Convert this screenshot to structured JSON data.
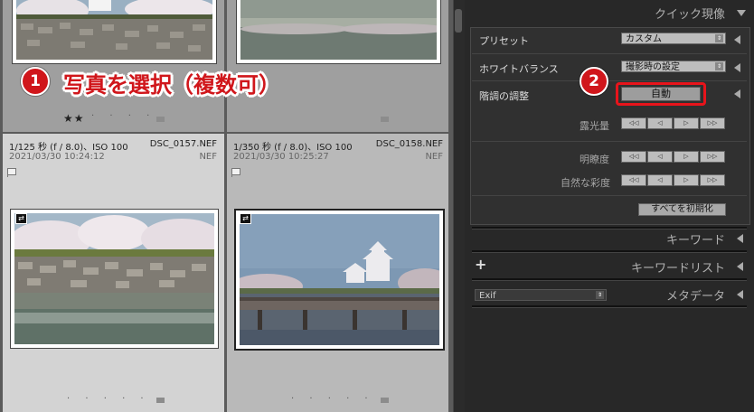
{
  "annotations": {
    "step1": {
      "number": "1",
      "text": "写真を選択（複数可）"
    },
    "step2": {
      "number": "2"
    }
  },
  "grid": {
    "top_row": {
      "rating": "★★",
      "rating_dots": "· · · ·"
    },
    "photos": [
      {
        "exposure": "1/125 秒 (f / 8.0)、ISO 100",
        "filename": "DSC_0157.NEF",
        "datetime": "2021/03/30 10:24:12",
        "filetype": "NEF",
        "sync_badge": "⇄",
        "dots": "· · · · ·"
      },
      {
        "exposure": "1/350 秒 (f / 8.0)、ISO 100",
        "filename": "DSC_0158.NEF",
        "datetime": "2021/03/30 10:25:27",
        "filetype": "NEF",
        "sync_badge": "⇄",
        "dots": "· · · · ·"
      }
    ]
  },
  "quick_develop": {
    "title": "クイック現像",
    "preset": {
      "label": "プリセット",
      "value": "カスタム"
    },
    "white_balance": {
      "label": "ホワイトバランス",
      "value": "撮影時の設定"
    },
    "tone": {
      "label": "階調の調整",
      "auto_button": "自動"
    },
    "exposure": {
      "label": "露光量",
      "buttons": [
        "◁◁",
        "◁",
        "▷",
        "▷▷"
      ]
    },
    "clarity": {
      "label": "明瞭度",
      "buttons": [
        "◁◁",
        "◁",
        "▷",
        "▷▷"
      ]
    },
    "vibrance": {
      "label": "自然な彩度",
      "buttons": [
        "◁◁",
        "◁",
        "▷",
        "▷▷"
      ]
    },
    "reset_button": "すべてを初期化"
  },
  "keywords": {
    "title": "キーワード"
  },
  "keyword_list": {
    "title": "キーワードリスト",
    "add_icon": "+"
  },
  "metadata": {
    "title": "メタデータ",
    "preset_value": "Exif"
  },
  "colors": {
    "accent_red": "#d0161b",
    "panel_bg": "#282828",
    "selected_cell": "#d3d3d3"
  }
}
